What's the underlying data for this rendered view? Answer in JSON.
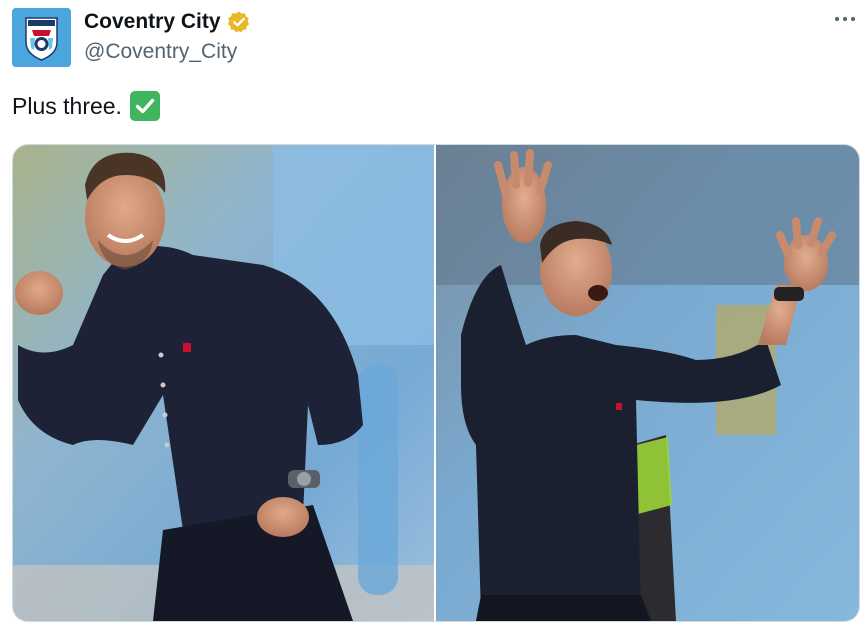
{
  "tweet": {
    "display_name": "Coventry City",
    "handle": "@Coventry_City",
    "text": "Plus three.",
    "verified_color": "#e8b829",
    "more_icon": "more-horizontal-icon",
    "emoji": "white-check-mark"
  },
  "media": {
    "photo_count": 2,
    "photos": [
      {
        "description_icon": "photo-celebrating-fist-pump"
      },
      {
        "description_icon": "photo-celebrating-arms-raised"
      }
    ]
  },
  "colors": {
    "text": "#0f1419",
    "secondary_text": "#536471",
    "border": "#cfd9de",
    "check_green": "#3fb55d",
    "stadium_blue": "#7fb4de"
  }
}
